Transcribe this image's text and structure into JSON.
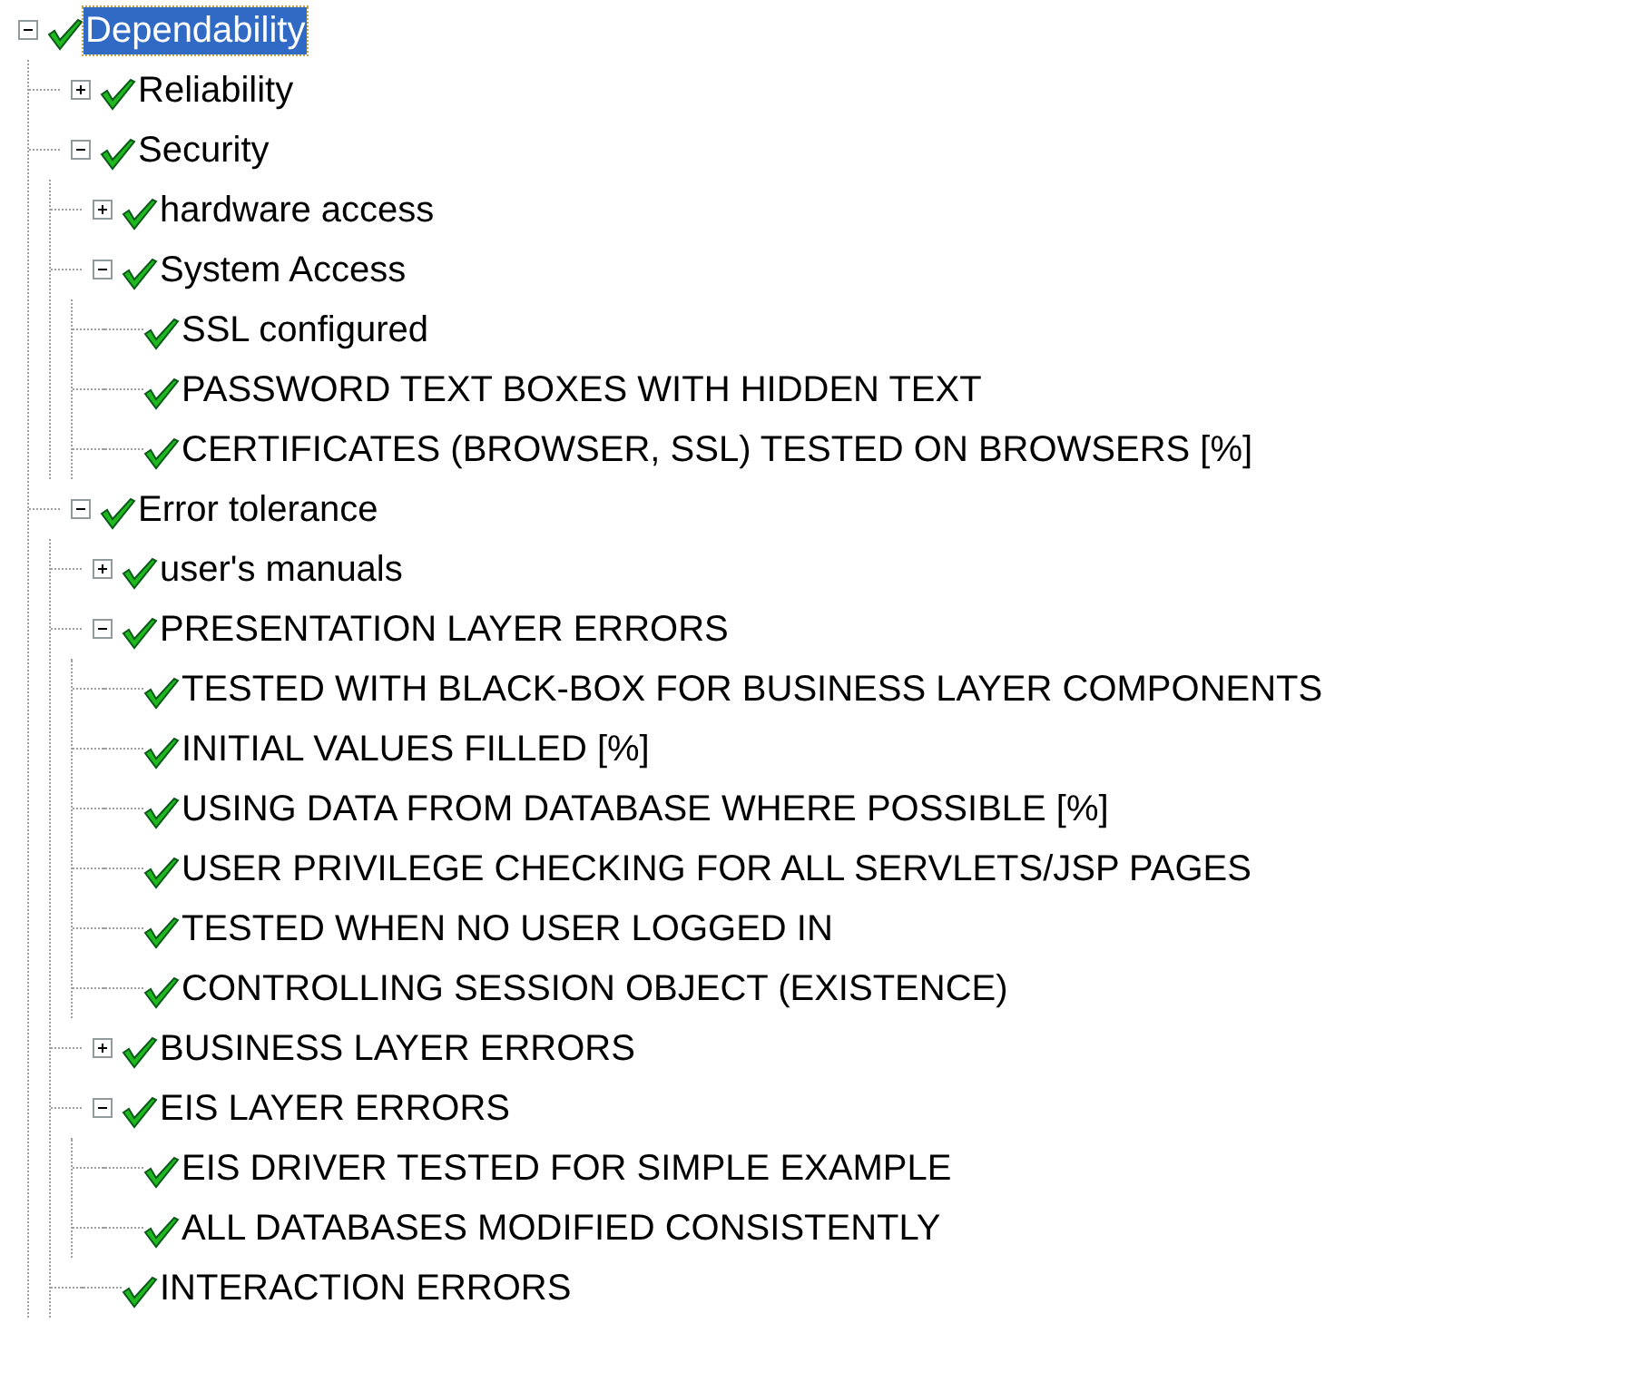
{
  "tree": [
    {
      "label": "Dependability",
      "selected": true,
      "checked": true,
      "expanded": true,
      "children": [
        {
          "label": "Reliability",
          "selected": false,
          "checked": true,
          "expanded": false
        },
        {
          "label": "Security",
          "selected": false,
          "checked": true,
          "expanded": true,
          "children": [
            {
              "label": "hardware access",
              "selected": false,
              "checked": true,
              "expanded": false
            },
            {
              "label": "System Access",
              "selected": false,
              "checked": true,
              "expanded": true,
              "children": [
                {
                  "label": "SSL configured",
                  "selected": false,
                  "checked": true
                },
                {
                  "label": "PASSWORD TEXT BOXES WITH HIDDEN TEXT",
                  "selected": false,
                  "checked": true
                },
                {
                  "label": "CERTIFICATES (BROWSER, SSL) TESTED ON BROWSERS [%]",
                  "selected": false,
                  "checked": true
                }
              ]
            }
          ]
        },
        {
          "label": "Error tolerance",
          "selected": false,
          "checked": true,
          "expanded": true,
          "children": [
            {
              "label": "user's manuals",
              "selected": false,
              "checked": true,
              "expanded": false
            },
            {
              "label": "PRESENTATION LAYER ERRORS",
              "selected": false,
              "checked": true,
              "expanded": true,
              "children": [
                {
                  "label": "TESTED WITH BLACK-BOX FOR BUSINESS LAYER COMPONENTS",
                  "selected": false,
                  "checked": true
                },
                {
                  "label": "INITIAL VALUES FILLED [%]",
                  "selected": false,
                  "checked": true
                },
                {
                  "label": "USING DATA FROM DATABASE WHERE POSSIBLE [%]",
                  "selected": false,
                  "checked": true
                },
                {
                  "label": "USER PRIVILEGE CHECKING FOR ALL SERVLETS/JSP PAGES",
                  "selected": false,
                  "checked": true
                },
                {
                  "label": "TESTED WHEN NO USER LOGGED IN",
                  "selected": false,
                  "checked": true
                },
                {
                  "label": "CONTROLLING SESSION OBJECT (EXISTENCE)",
                  "selected": false,
                  "checked": true
                }
              ]
            },
            {
              "label": "BUSINESS LAYER ERRORS",
              "selected": false,
              "checked": true,
              "expanded": false
            },
            {
              "label": "EIS LAYER ERRORS",
              "selected": false,
              "checked": true,
              "expanded": true,
              "children": [
                {
                  "label": "EIS DRIVER TESTED FOR SIMPLE EXAMPLE",
                  "selected": false,
                  "checked": true
                },
                {
                  "label": "ALL DATABASES MODIFIED CONSISTENTLY",
                  "selected": false,
                  "checked": true
                }
              ]
            },
            {
              "label": "INTERACTION ERRORS",
              "selected": false,
              "checked": true
            }
          ]
        }
      ]
    }
  ]
}
